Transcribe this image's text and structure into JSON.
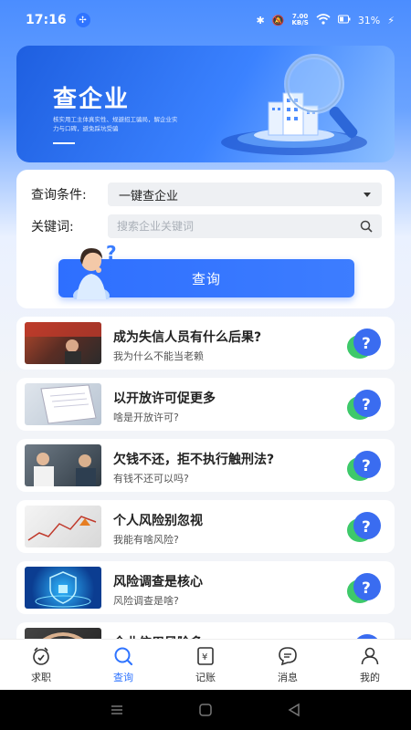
{
  "status_bar": {
    "time": "17:16",
    "net_speed_top": "7.00",
    "net_speed_unit": "KB/S",
    "battery": "31%"
  },
  "banner": {
    "title": "查企业",
    "description": "核实用工主体真实性、规避招工骗局，解企业实力与口碑，避免踩坑受骗"
  },
  "query_form": {
    "condition_label": "查询条件:",
    "condition_value": "一键查企业",
    "keyword_label": "关键词:",
    "keyword_placeholder": "搜索企业关键词",
    "submit_label": "查询"
  },
  "articles": [
    {
      "title": "成为失信人员有什么后果?",
      "subtitle": "我为什么不能当老赖"
    },
    {
      "title": "以开放许可促更多",
      "subtitle": "啥是开放许可?"
    },
    {
      "title": "欠钱不还，拒不执行触刑法?",
      "subtitle": "有钱不还可以吗?"
    },
    {
      "title": "个人风险别忽视",
      "subtitle": "我能有啥风险?"
    },
    {
      "title": "风险调查是核心",
      "subtitle": "风险调查是啥?"
    },
    {
      "title": "企业信用风险多",
      "subtitle": ""
    }
  ],
  "bottom_nav": [
    {
      "label": "求职",
      "icon": "job-icon",
      "active": false
    },
    {
      "label": "查询",
      "icon": "search-icon",
      "active": true
    },
    {
      "label": "记账",
      "icon": "ledger-icon",
      "active": false
    },
    {
      "label": "消息",
      "icon": "message-icon",
      "active": false
    },
    {
      "label": "我的",
      "icon": "profile-icon",
      "active": false
    }
  ],
  "colors": {
    "accent": "#2f74ff",
    "banner_start": "#1e5fe0",
    "question_blue": "#3a6cf0",
    "question_green": "#3ec96a"
  }
}
